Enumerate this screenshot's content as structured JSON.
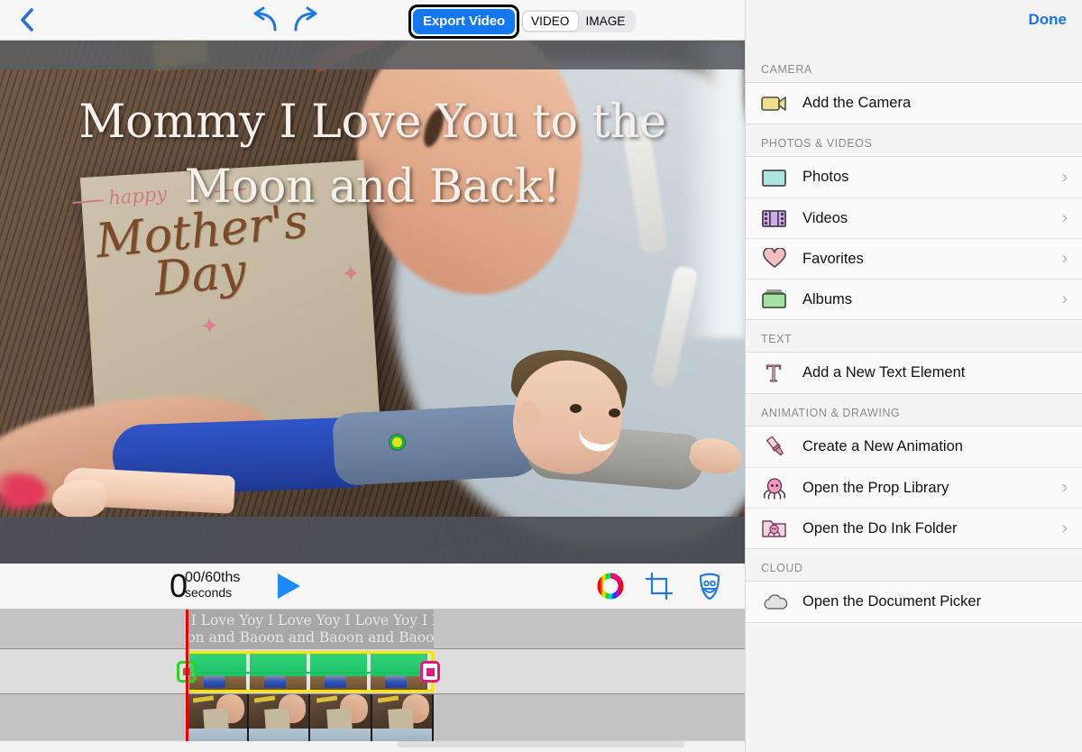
{
  "toolbar": {
    "back_icon": "chevron-left-icon",
    "undo_icon": "undo-icon",
    "redo_icon": "redo-icon",
    "export_label": "Export Video",
    "segments": [
      {
        "label": "VIDEO",
        "active": true
      },
      {
        "label": "IMAGE",
        "active": false
      }
    ]
  },
  "canvas": {
    "title_line1": "Mommy I Love You to the",
    "title_line2": "Moon and Back!",
    "card_happy": "happy",
    "card_mothers": "Mother's",
    "card_day": "Day",
    "selection_handle": "boy-selection-handle"
  },
  "playbar": {
    "time_number": "0",
    "time_fraction": "00/60ths",
    "time_unit": "seconds",
    "play_icon": "play-icon",
    "tools": [
      {
        "name": "color-wheel-icon"
      },
      {
        "name": "crop-icon"
      },
      {
        "name": "mask-icon"
      }
    ]
  },
  "timeline": {
    "text_clip_line1": "y I Love Yoy I Love Yoy I Love Yoy I Love",
    "text_clip_line2": "oon and Baoon and Baoon and Baoon and",
    "video_clip_label": "green-screen-video-clip",
    "film_clip_label": "background-film-strip-clip",
    "handle_left": "trim-handle-left",
    "handle_right": "trim-handle-right",
    "playhead": "playhead"
  },
  "panel": {
    "done_label": "Done",
    "sections": [
      {
        "title": "CAMERA",
        "items": [
          {
            "label": "Add the Camera",
            "icon": "video-camera-icon",
            "chevron": false
          }
        ]
      },
      {
        "title": "PHOTOS & VIDEOS",
        "items": [
          {
            "label": "Photos",
            "icon": "photo-icon",
            "chevron": true
          },
          {
            "label": "Videos",
            "icon": "film-strip-icon",
            "chevron": true
          },
          {
            "label": "Favorites",
            "icon": "heart-icon",
            "chevron": true
          },
          {
            "label": "Albums",
            "icon": "albums-icon",
            "chevron": true
          }
        ]
      },
      {
        "title": "TEXT",
        "items": [
          {
            "label": "Add a New Text Element",
            "icon": "text-t-icon",
            "chevron": false
          }
        ]
      },
      {
        "title": "ANIMATION & DRAWING",
        "items": [
          {
            "label": "Create a New Animation",
            "icon": "paintbrush-icon",
            "chevron": false
          },
          {
            "label": "Open the Prop Library",
            "icon": "octopus-icon",
            "chevron": true
          },
          {
            "label": "Open the Do Ink Folder",
            "icon": "folder-octopus-icon",
            "chevron": true
          }
        ]
      },
      {
        "title": "CLOUD",
        "items": [
          {
            "label": "Open the Document Picker",
            "icon": "cloud-icon",
            "chevron": false
          }
        ]
      }
    ]
  },
  "colors": {
    "accent_blue": "#1576f0",
    "play_blue": "#1e8aff",
    "selection_yellow": "#ffe400",
    "handle_green": "#2bd41e",
    "handle_pink": "#e4197c",
    "playhead_red": "#ee0000",
    "clip_green": "#29cf6e"
  }
}
